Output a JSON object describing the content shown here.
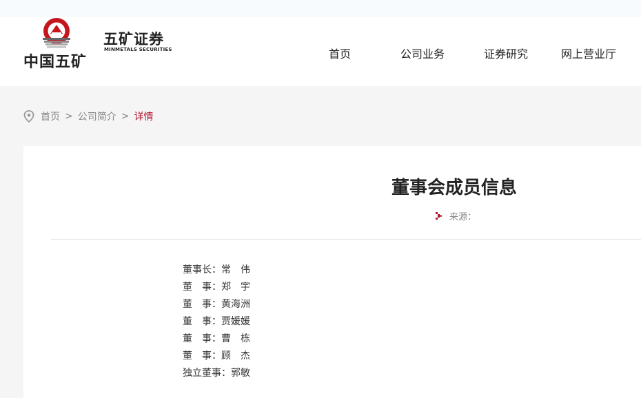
{
  "brand": {
    "cn_name": "中国五矿",
    "emblem_text": "MINMETALS",
    "securities_cn": "五矿证券",
    "securities_en": "MINMETALS SECURITIES"
  },
  "nav": {
    "items": [
      "首页",
      "公司业务",
      "证券研究",
      "网上营业厅"
    ]
  },
  "breadcrumb": {
    "icon": "location-pin-icon",
    "items": [
      "首页",
      "公司简介"
    ],
    "current": "详情",
    "separator": ">"
  },
  "article": {
    "title": "董事会成员信息",
    "source_label": "来源：",
    "members": [
      "董事长：常　伟",
      "董　事：郑　宇",
      "董　事：黄海洲",
      "董　事：贾媛媛",
      "董　事：曹　栋",
      "董　事：顾　杰",
      "独立董事：郭敏"
    ]
  },
  "colors": {
    "accent": "#b0132e",
    "text": "#222222",
    "muted": "#888888",
    "background": "#f5f5f5"
  }
}
